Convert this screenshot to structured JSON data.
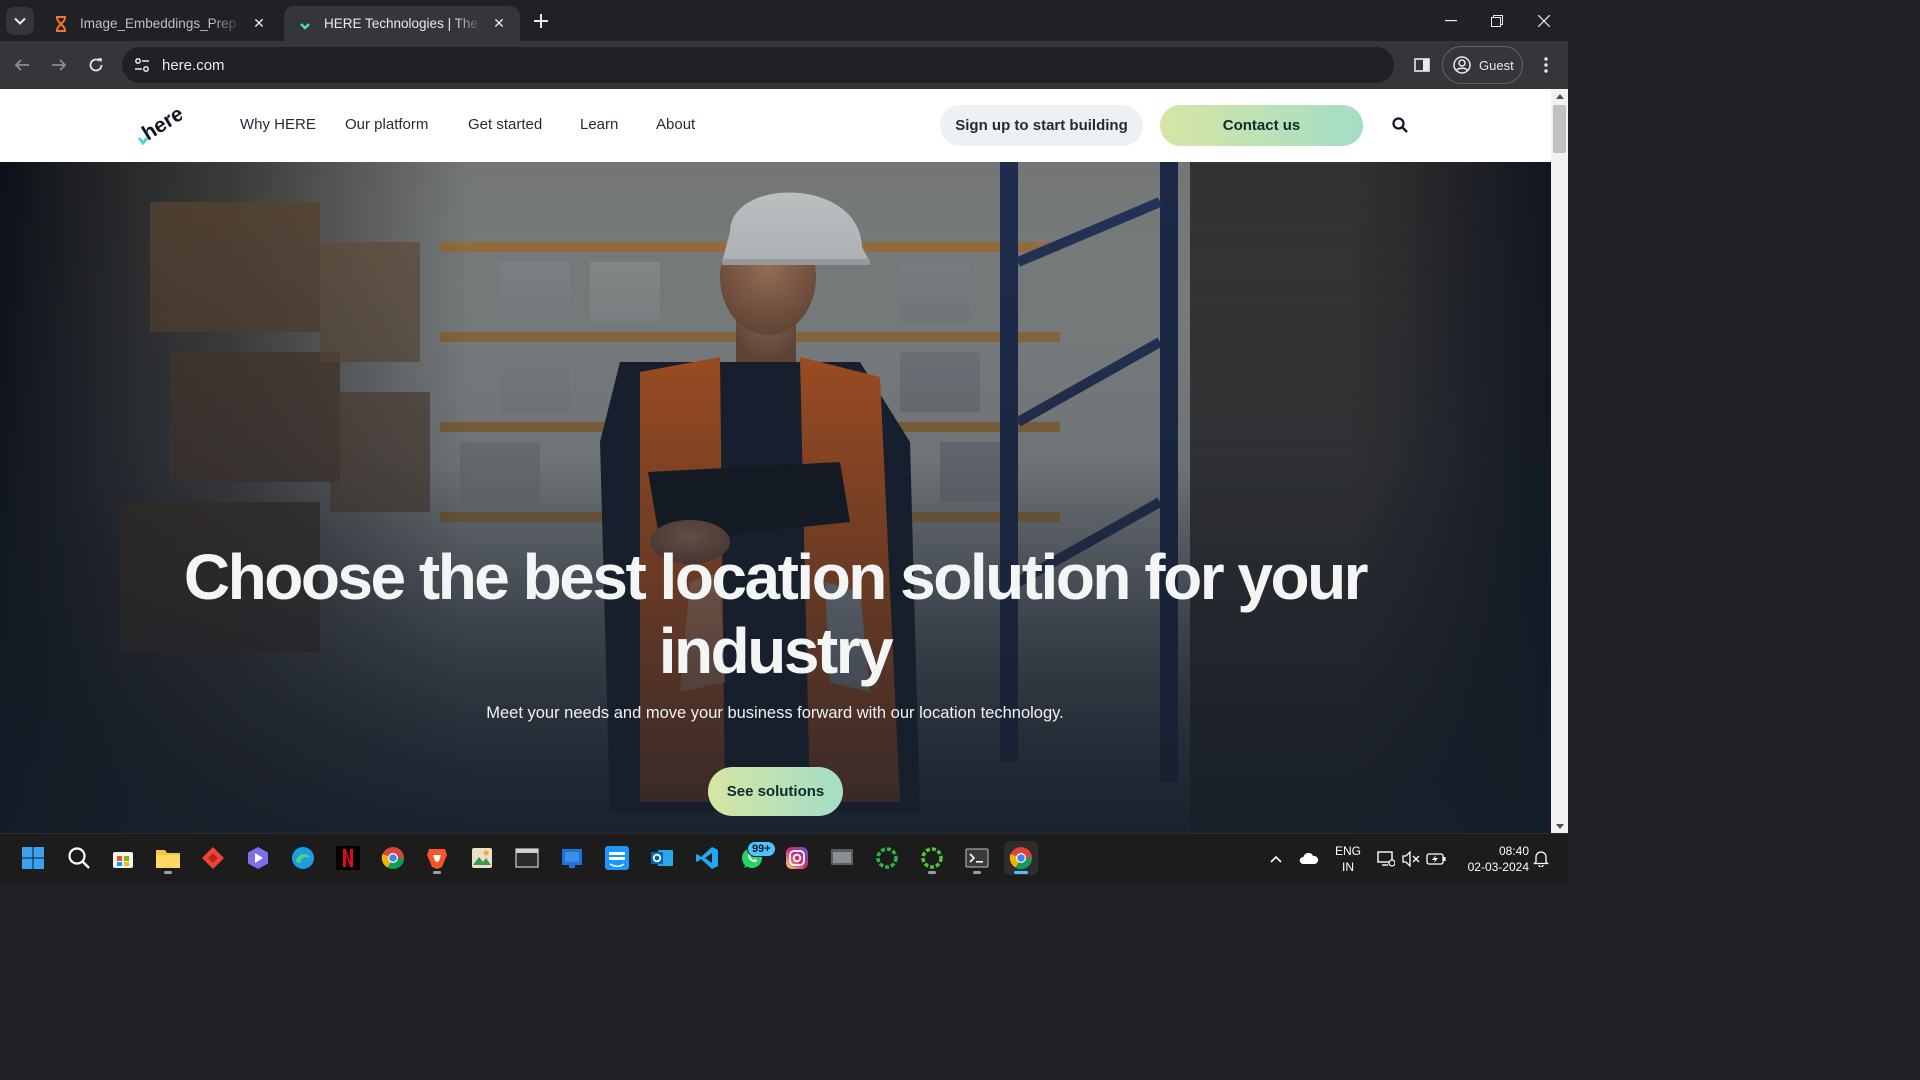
{
  "browser": {
    "tabs": [
      {
        "title": "Image_Embeddings_Prep - Jupyter",
        "active": false
      },
      {
        "title": "HERE Technologies | The world's",
        "active": true
      }
    ],
    "url": "here.com",
    "profile_label": "Guest"
  },
  "site": {
    "brand": "here",
    "nav": [
      "Why HERE",
      "Our platform",
      "Get started",
      "Learn",
      "About"
    ],
    "signup_label": "Sign up to start building",
    "contact_label": "Contact us",
    "accent_gradient": [
      "#d6e6a3",
      "#a4ddc6"
    ],
    "hero": {
      "title": "Choose the best location solution for your industry",
      "subtitle": "Meet your needs and move your business forward with our location technology.",
      "cta": "See solutions"
    }
  },
  "taskbar": {
    "apps": [
      "windows-start",
      "search",
      "microsoft-store",
      "file-explorer",
      "anydesk",
      "app-launcher",
      "microsoft-edge",
      "netflix",
      "google-chrome",
      "brave",
      "photos",
      "terminal-window",
      "windows-app",
      "prime-video",
      "outlook",
      "vs-code",
      "whatsapp",
      "instagram",
      "virtual-machine",
      "ring-app-1",
      "ring-app-2",
      "command-prompt",
      "google-chrome-active"
    ],
    "whatsapp_badge": "99+",
    "language": [
      "ENG",
      "IN"
    ],
    "time": "08:40",
    "date": "02-03-2024"
  }
}
